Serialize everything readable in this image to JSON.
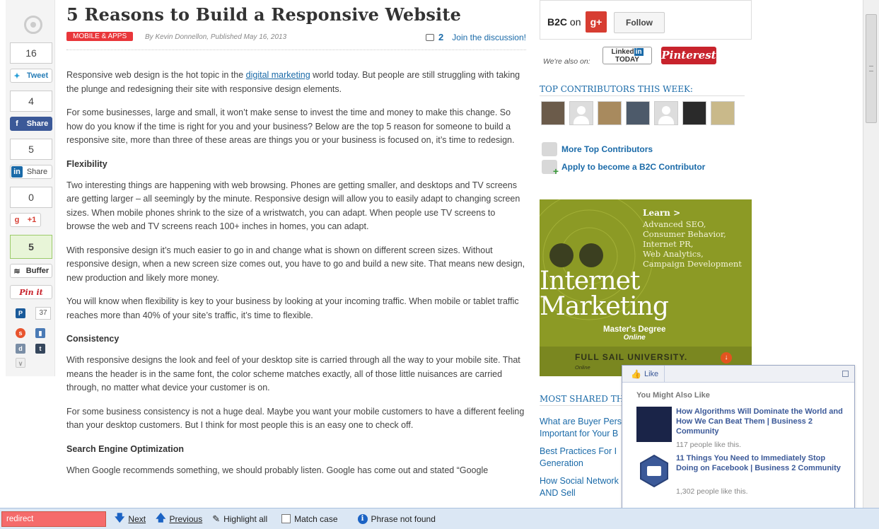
{
  "article": {
    "title": "5 Reasons to Build a Responsive Website",
    "category": "MOBILE & APPS",
    "byline": "By Kevin Donnellon, Published May 16, 2013",
    "comment_count": "2",
    "discussion_link": "Join the discussion!",
    "p1_pre": "Responsive web design is the hot topic in the ",
    "p1_link": "digital marketing",
    "p1_post": " world today. But people are still struggling with taking the plunge and redesigning their site with responsive design elements.",
    "p2": "For some businesses, large and small, it won’t make sense to invest the time and money to make this change. So how do you know if the time is right for you and your business? Below are the top 5 reason for someone to build a responsive site, more than three of these areas are things you or your business is focused on, it’s time to redesign.",
    "h_flex": "Flexibility",
    "p3": "Two interesting things are happening with web browsing. Phones are getting smaller, and desktops and TV screens are getting larger – all seemingly by the minute. Responsive design will allow you to easily adapt to changing screen sizes. When mobile phones shrink to the size of a wristwatch, you can adapt. When people use TV screens to browse the web and TV screens reach 100+ inches in homes, you can adapt.",
    "p4": "With responsive design it’s much easier to go in and change what is shown on different screen sizes. Without responsive design, when a new screen size comes out, you have to go and build a new site. That means new design, new production and likely more money.",
    "p5": "You will know when flexibility is key to your business by looking at your incoming traffic. When mobile or tablet traffic reaches more than 40% of your site’s traffic, it’s time to flexible.",
    "h_consist": "Consistency",
    "p6": "With responsive designs the look and feel of your desktop site is carried through all the way to your mobile site. That means the header is in the same font, the color scheme matches exactly, all of those little nuisances are carried through, no matter what device your customer is on.",
    "p7": "For some business consistency is not a huge deal. Maybe you want your mobile customers to have a different feeling than your desktop customers. But I think for most people this is an easy one to check off.",
    "h_seo": "Search Engine Optimization",
    "p8": "When Google recommends something, we should probably listen. Google has come out and stated “Google"
  },
  "share": {
    "tweet_count": "16",
    "tweet_label": "Tweet",
    "fb_count": "4",
    "fb_label": "Share",
    "li_count": "5",
    "li_label": "Share",
    "gplus_count": "0",
    "gplus_label": "+1",
    "buffer_count": "5",
    "buffer_label": "Buffer",
    "pin_label": "Pin it",
    "pin_count": "37"
  },
  "sidebar": {
    "brand": "B2C",
    "on": "on",
    "gplus_glyph": "g+",
    "follow": "Follow",
    "also_on": "We're also on:",
    "linkedin_line1": "Linked",
    "linkedin_in": "in",
    "linkedin_line2": "TODAY",
    "pinterest": "Pinterest",
    "top_contributors": "TOP CONTRIBUTORS THIS WEEK:",
    "more_contributors": "More Top Contributors",
    "apply": "Apply to become a B2C Contributor",
    "most_shared": "MOST SHARED THI",
    "most_shared_items": [
      "What are Buyer Pers",
      "Important for Your B",
      "Best Practices For I",
      "Generation",
      "How Social Network",
      "AND Sell"
    ]
  },
  "ad": {
    "learn": "Learn >",
    "items": [
      "Advanced SEO,",
      "Consumer Behavior,",
      "Internet PR,",
      "Web Analytics,",
      "Campaign Development"
    ],
    "headline1": "Internet",
    "headline2": "Marketing",
    "masters": "Master's Degree",
    "online": "Online",
    "school": "FULL SAIL UNIVERSITY.",
    "school_sub": "Online",
    "arrow": "↓"
  },
  "facebook": {
    "like": "Like",
    "subtitle": "You Might Also Like",
    "items": [
      {
        "title": "How Algorithms Will Dominate the World and How We Can Beat Them | Business 2 Community",
        "count": "117 people like this."
      },
      {
        "title": "11 Things You Need to Immediately Stop Doing on Facebook | Business 2 Community",
        "count": "1,302 people like this."
      }
    ]
  },
  "findbar": {
    "query": "redirect",
    "next": "Next",
    "previous": "Previous",
    "highlight_all": "Highlight all",
    "match_case": "Match case",
    "status": "Phrase not found"
  },
  "colors": {
    "accent_link": "#1a6aa8",
    "category_red": "#e9363a",
    "ad_green": "#8c9a25",
    "find_error": "#f56b6b"
  }
}
